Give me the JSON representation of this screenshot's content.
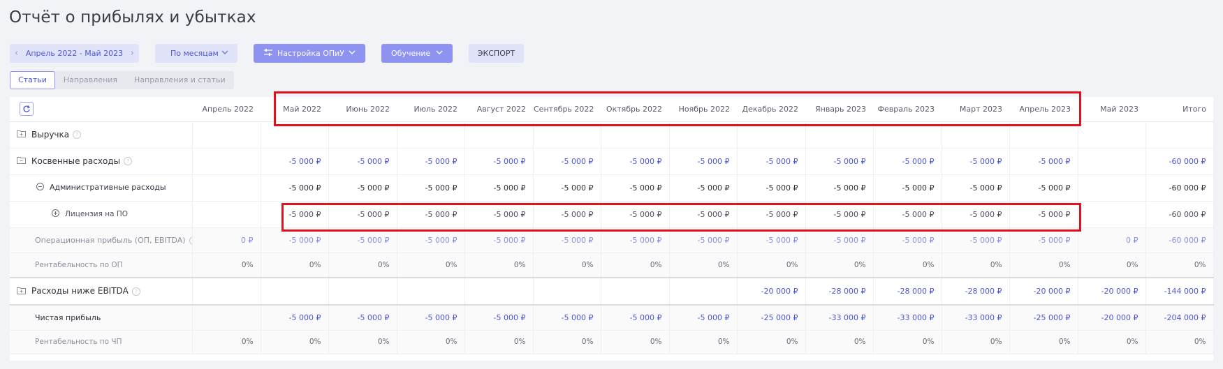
{
  "page": {
    "title": "Отчёт о прибылях и убытках"
  },
  "toolbar": {
    "period": "Апрель 2022 - Май 2023",
    "grouping": "По месяцам",
    "settings": "Настройка ОПиУ",
    "training": "Обучение",
    "export": "ЭКСПОРТ"
  },
  "tabs": [
    "Статьи",
    "Направления",
    "Направления и статьи"
  ],
  "table": {
    "columns": [
      "Апрель 2022",
      "Май 2022",
      "Июнь 2022",
      "Июль 2022",
      "Август 2022",
      "Сентябрь 2022",
      "Октябрь 2022",
      "Ноябрь 2022",
      "Декабрь 2022",
      "Январь 2023",
      "Февраль 2023",
      "Март 2023",
      "Апрель 2023",
      "Май 2023",
      "Итого"
    ],
    "rows": [
      {
        "label": "Выручка",
        "values": [
          "",
          "",
          "",
          "",
          "",
          "",
          "",
          "",
          "",
          "",
          "",
          "",
          "",
          "",
          ""
        ]
      },
      {
        "label": "Косвенные расходы",
        "values": [
          "",
          "-5 000 ₽",
          "-5 000 ₽",
          "-5 000 ₽",
          "-5 000 ₽",
          "-5 000 ₽",
          "-5 000 ₽",
          "-5 000 ₽",
          "-5 000 ₽",
          "-5 000 ₽",
          "-5 000 ₽",
          "-5 000 ₽",
          "-5 000 ₽",
          "",
          "-60 000 ₽"
        ]
      },
      {
        "label": "Административные расходы",
        "values": [
          "",
          "-5 000 ₽",
          "-5 000 ₽",
          "-5 000 ₽",
          "-5 000 ₽",
          "-5 000 ₽",
          "-5 000 ₽",
          "-5 000 ₽",
          "-5 000 ₽",
          "-5 000 ₽",
          "-5 000 ₽",
          "-5 000 ₽",
          "-5 000 ₽",
          "",
          "-60 000 ₽"
        ]
      },
      {
        "label": "Лицензия на ПО",
        "values": [
          "",
          "-5 000 ₽",
          "-5 000 ₽",
          "-5 000 ₽",
          "-5 000 ₽",
          "-5 000 ₽",
          "-5 000 ₽",
          "-5 000 ₽",
          "-5 000 ₽",
          "-5 000 ₽",
          "-5 000 ₽",
          "-5 000 ₽",
          "-5 000 ₽",
          "",
          "-60 000 ₽"
        ]
      },
      {
        "label": "Операционная прибыль (ОП, EBITDA)",
        "values": [
          "0 ₽",
          "-5 000 ₽",
          "-5 000 ₽",
          "-5 000 ₽",
          "-5 000 ₽",
          "-5 000 ₽",
          "-5 000 ₽",
          "-5 000 ₽",
          "-5 000 ₽",
          "-5 000 ₽",
          "-5 000 ₽",
          "-5 000 ₽",
          "-5 000 ₽",
          "0 ₽",
          "-60 000 ₽"
        ]
      },
      {
        "label": "Рентабельность по ОП",
        "values": [
          "0%",
          "0%",
          "0%",
          "0%",
          "0%",
          "0%",
          "0%",
          "0%",
          "0%",
          "0%",
          "0%",
          "0%",
          "0%",
          "0%",
          "0%"
        ]
      },
      {
        "label": "Расходы ниже EBITDA",
        "values": [
          "",
          "",
          "",
          "",
          "",
          "",
          "",
          "",
          "-20 000 ₽",
          "-28 000 ₽",
          "-28 000 ₽",
          "-28 000 ₽",
          "-20 000 ₽",
          "-20 000 ₽",
          "-144 000 ₽"
        ]
      },
      {
        "label": "Чистая прибыль",
        "values": [
          "",
          "-5 000 ₽",
          "-5 000 ₽",
          "-5 000 ₽",
          "-5 000 ₽",
          "-5 000 ₽",
          "-5 000 ₽",
          "-5 000 ₽",
          "-25 000 ₽",
          "-33 000 ₽",
          "-33 000 ₽",
          "-33 000 ₽",
          "-25 000 ₽",
          "-20 000 ₽",
          "-204 000 ₽"
        ]
      },
      {
        "label": "Рентабельность по ЧП",
        "values": [
          "0%",
          "0%",
          "0%",
          "0%",
          "0%",
          "0%",
          "0%",
          "0%",
          "0%",
          "0%",
          "0%",
          "0%",
          "0%",
          "0%",
          "0%"
        ]
      }
    ]
  },
  "icons": {
    "refresh": "refresh-icon",
    "folder": "folder-icon",
    "collapse": "minus-circle-icon",
    "expand": "plus-circle-icon",
    "info": "info-icon"
  },
  "colors": {
    "accent": "#4b55d7",
    "primary_button": "#8e92f0",
    "highlight": "#e2111c"
  }
}
